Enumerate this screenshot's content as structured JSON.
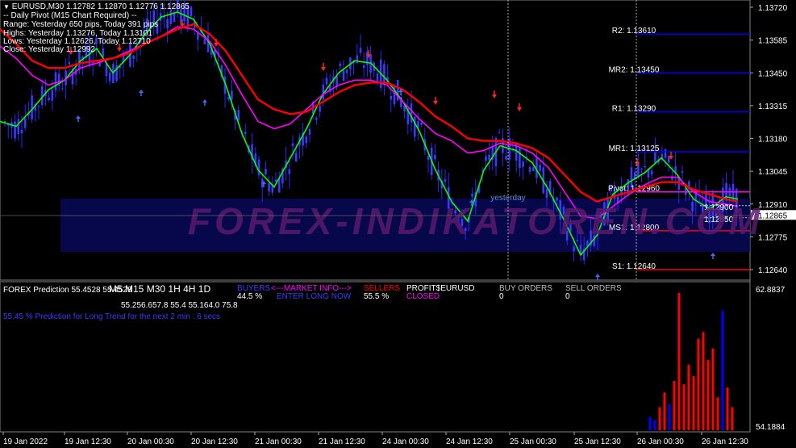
{
  "window": {
    "symbol_info": "EURUSD,M30  1.12782 1.12870 1.12776 1.12865"
  },
  "pivot_info": {
    "title": "-- Daily Pivot (M15 Chart Required) --",
    "range": "Range: Yesterday 650 pips, Today 391 pips",
    "highs": "Highs: Yesterday 1.13276, Today 1.13101",
    "lows": "Lows:  Yesterday 1.12626, Today 1.12710",
    "close": "Close: Yesterday 1.12992"
  },
  "pivot_levels": [
    {
      "label": "R2: 1.13610",
      "value": 1.1361,
      "color": "#0000ff"
    },
    {
      "label": "MR2: 1.13450",
      "value": 1.1345,
      "color": "#0000ff"
    },
    {
      "label": "R1: 1.13290",
      "value": 1.1329,
      "color": "#0000ff"
    },
    {
      "label": "MR1: 1.13125",
      "value": 1.13125,
      "color": "#0000ff"
    },
    {
      "label": "Pivot: 1.12960",
      "value": 1.1296,
      "color": "#ff00ff"
    },
    {
      "label": "MS1: 1.12800",
      "value": 1.128,
      "color": "#ff0000"
    },
    {
      "label": "S1: 1.12640",
      "value": 1.1264,
      "color": "#ff0000"
    }
  ],
  "yesterday_label": "yesterday",
  "watermark": "FOREX-INDIKATOREN.COM",
  "price_axis": {
    "ticks": [
      "1.13720",
      "1.13585",
      "1.13450",
      "1.13315",
      "1.13180",
      "1.13045",
      "1.12910",
      "1.12775",
      "1.12640"
    ],
    "current": "1.12865",
    "right_labels": [
      "1.12900",
      "1.12850"
    ]
  },
  "time_axis": [
    "19 Jan 2022",
    "19 Jan 12:30",
    "20 Jan 00:30",
    "20 Jan 12:30",
    "21 Jan 00:30",
    "21 Jan 12:30",
    "24 Jan 00:30",
    "24 Jan 12:30",
    "25 Jan 00:30",
    "25 Jan 12:30",
    "26 Jan 00:30",
    "26 Jan 12:30"
  ],
  "sub_window": {
    "title": "FOREX Prediction 55.4528 55.4528",
    "scale_max": "62.8837",
    "scale_min": "54.1884",
    "timeframes": [
      "M5",
      "M15",
      "M30",
      "1H",
      "4H",
      "1D"
    ],
    "tf_values": [
      "55.2",
      "56.6",
      "57.8",
      "55.4",
      "55.1",
      "64.0",
      "75.8"
    ],
    "buyers_label": "BUYERS",
    "buyers_value": "44.5 %",
    "market_info": "<---MARKET INFO--->",
    "enter_signal": "ENTER LONG NOW",
    "sellers_label": "SELLERS",
    "sellers_value": "55.5 %",
    "profit_label": "PROFIT$EURUSD",
    "closed_label": "CLOSED",
    "buy_orders_label": "BUY ORDERS",
    "buy_orders_value": "0",
    "sell_orders_label": "SELL ORDERS",
    "sell_orders_value": "0",
    "prediction_text": "55.45 % Prediction for Long Trend for the next 2 min : 6 secs"
  },
  "chart_data": {
    "type": "line",
    "series": [
      {
        "color": "#00ff00",
        "x": [
          0,
          20,
          40,
          60,
          80,
          100,
          120,
          140,
          160,
          180,
          200,
          220,
          240,
          260,
          280,
          300,
          320,
          340,
          360,
          380,
          400,
          420,
          440,
          460,
          480,
          500,
          520,
          540,
          560,
          580,
          600,
          620,
          640,
          660,
          680,
          700,
          720,
          740,
          760,
          780,
          800,
          820,
          840,
          860,
          880,
          900,
          915
        ],
        "y": [
          1.1325,
          1.1323,
          1.133,
          1.1338,
          1.1342,
          1.135,
          1.1355,
          1.1345,
          1.1352,
          1.1361,
          1.1368,
          1.137,
          1.1367,
          1.1357,
          1.134,
          1.132,
          1.1305,
          1.1298,
          1.131,
          1.1322,
          1.1336,
          1.1345,
          1.135,
          1.1349,
          1.1342,
          1.1333,
          1.1321,
          1.1305,
          1.1292,
          1.1284,
          1.1305,
          1.1315,
          1.1313,
          1.1308,
          1.1297,
          1.1284,
          1.127,
          1.1278,
          1.1295,
          1.13,
          1.1304,
          1.131,
          1.1303,
          1.1293,
          1.1289,
          1.1294,
          1.1293
        ]
      },
      {
        "color": "#ff00ff",
        "x": [
          0,
          20,
          40,
          60,
          80,
          100,
          120,
          140,
          160,
          180,
          200,
          220,
          240,
          260,
          280,
          300,
          320,
          340,
          360,
          380,
          400,
          420,
          440,
          460,
          480,
          500,
          520,
          540,
          560,
          580,
          600,
          620,
          640,
          660,
          680,
          700,
          720,
          740,
          760,
          780,
          800,
          820,
          840,
          860,
          880,
          900,
          915
        ],
        "y": [
          1.1356,
          1.1351,
          1.1344,
          1.134,
          1.1342,
          1.1347,
          1.1349,
          1.1351,
          1.1354,
          1.1357,
          1.136,
          1.1364,
          1.1363,
          1.1358,
          1.1348,
          1.1336,
          1.1325,
          1.1322,
          1.1324,
          1.133,
          1.1336,
          1.134,
          1.1342,
          1.1342,
          1.134,
          1.1333,
          1.1326,
          1.132,
          1.1317,
          1.1312,
          1.1313,
          1.1316,
          1.1315,
          1.1312,
          1.1306,
          1.1296,
          1.1286,
          1.1285,
          1.129,
          1.1295,
          1.1299,
          1.1302,
          1.1302,
          1.1296,
          1.1292,
          1.1291,
          1.129
        ]
      },
      {
        "color": "#ff0000",
        "x": [
          0,
          20,
          40,
          60,
          80,
          100,
          120,
          140,
          160,
          180,
          200,
          220,
          240,
          260,
          280,
          300,
          320,
          340,
          360,
          380,
          400,
          420,
          440,
          460,
          480,
          500,
          520,
          540,
          560,
          580,
          600,
          620,
          640,
          660,
          680,
          700,
          720,
          740,
          760,
          780,
          800,
          820,
          840,
          860,
          880,
          900,
          915
        ],
        "y": [
          1.1363,
          1.1357,
          1.135,
          1.1347,
          1.1347,
          1.1349,
          1.135,
          1.1351,
          1.1353,
          1.1357,
          1.136,
          1.1363,
          1.1365,
          1.1361,
          1.1354,
          1.1344,
          1.1334,
          1.133,
          1.1328,
          1.1329,
          1.1333,
          1.1337,
          1.134,
          1.1341,
          1.1341,
          1.1338,
          1.1333,
          1.1327,
          1.1323,
          1.1318,
          1.1317,
          1.1317,
          1.1316,
          1.1314,
          1.131,
          1.1303,
          1.1296,
          1.1292,
          1.1294,
          1.1296,
          1.1298,
          1.13,
          1.13,
          1.1297,
          1.1295,
          1.1293,
          1.1292
        ]
      }
    ],
    "histogram": {
      "x": [
        806,
        812,
        818,
        824,
        830,
        836,
        842,
        848,
        854,
        860,
        866,
        872,
        878,
        884,
        890,
        896,
        902,
        908
      ],
      "values": [
        55.0,
        54.8,
        55.6,
        56.5,
        55.8,
        57.2,
        62.6,
        57.0,
        58.2,
        57.5,
        59.8,
        60.2,
        58.5,
        59.2,
        56.2,
        61.5,
        56.8,
        55.6
      ],
      "colors": [
        "#0000ff",
        "#0000ff",
        "#ff0000",
        "#ff0000",
        "#0000ff",
        "#ff0000",
        "#ff0000",
        "#ff0000",
        "#ff0000",
        "#ff0000",
        "#ff0000",
        "#ff0000",
        "#ff0000",
        "#ff0000",
        "#ff0000",
        "#0000ff",
        "#ff0000",
        "#ff0000"
      ]
    }
  }
}
